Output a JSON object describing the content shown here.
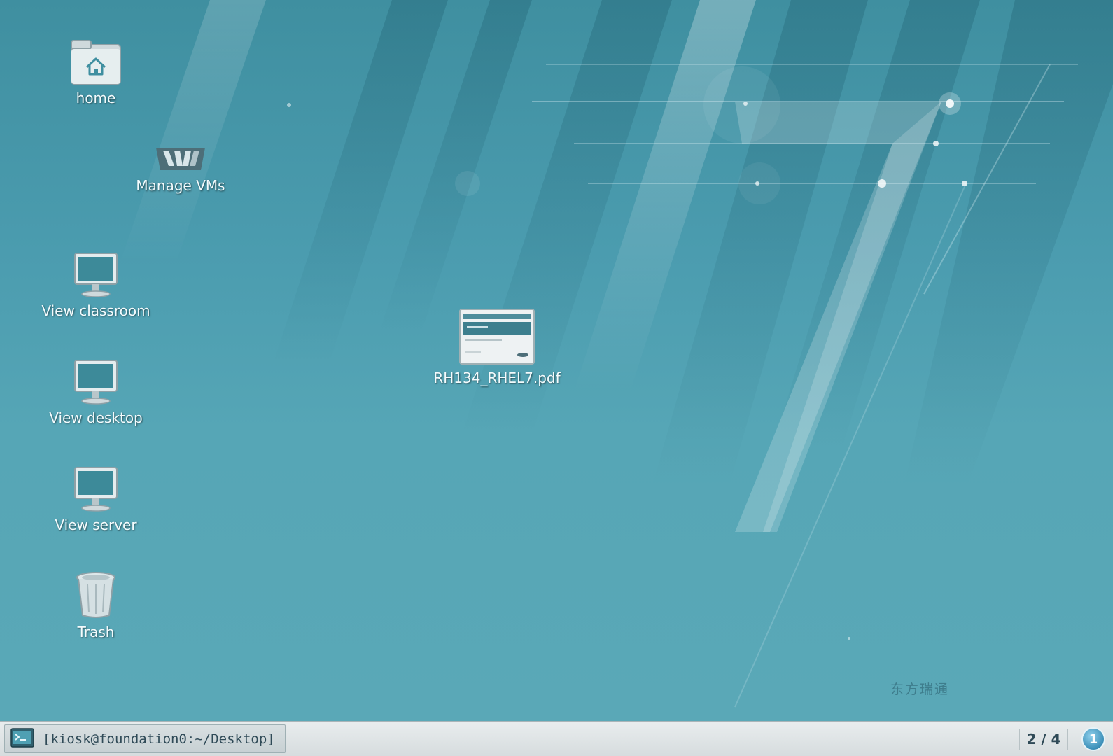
{
  "desktop": {
    "icons": [
      {
        "label": "home",
        "icon": "home-folder-icon"
      },
      {
        "label": "Manage VMs",
        "icon": "virt-manager-icon"
      },
      {
        "label": "View classroom",
        "icon": "monitor-icon"
      },
      {
        "label": "View desktop",
        "icon": "monitor-icon"
      },
      {
        "label": "View server",
        "icon": "monitor-icon"
      },
      {
        "label": "Trash",
        "icon": "trash-icon"
      },
      {
        "label": "RH134_RHEL7.pdf",
        "icon": "pdf-document-icon"
      }
    ],
    "watermark": "东方瑞通"
  },
  "panel": {
    "window_title": "[kiosk@foundation0:~/Desktop]",
    "workspace": "2 / 4",
    "notification_count": "1"
  },
  "colors": {
    "desktop_bg": "#56a6b6",
    "panel_bg": "#dfe4e6",
    "accent": "#3b8fb8"
  }
}
